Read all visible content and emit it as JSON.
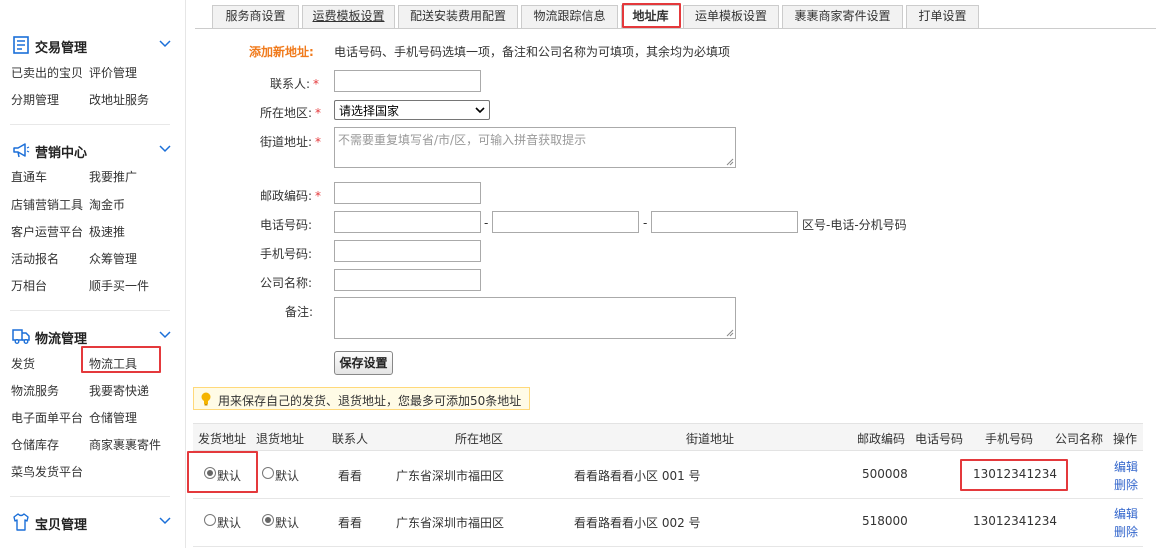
{
  "sidebar": {
    "sections": [
      {
        "title": "交易管理",
        "icon": "list-icon",
        "items": [
          "已卖出的宝贝",
          "评价管理",
          "分期管理",
          "改地址服务"
        ]
      },
      {
        "title": "营销中心",
        "icon": "megaphone-icon",
        "items": [
          "直通车",
          "我要推广",
          "店铺营销工具",
          "淘金币",
          "客户运营平台",
          "极速推",
          "活动报名",
          "众筹管理",
          "万相台",
          "顺手买一件"
        ]
      },
      {
        "title": "物流管理",
        "icon": "truck-icon",
        "items": [
          "发货",
          "物流工具",
          "物流服务",
          "我要寄快递",
          "电子面单平台",
          "仓储管理",
          "仓储库存",
          "商家裹裹寄件",
          "菜鸟发货平台"
        ]
      },
      {
        "title": "宝贝管理",
        "icon": "shirt-icon",
        "items": []
      }
    ]
  },
  "tabs": [
    "服务商设置",
    "运费模板设置",
    "配送安装费用配置",
    "物流跟踪信息",
    "地址库",
    "运单模板设置",
    "裹裹商家寄件设置",
    "打单设置"
  ],
  "active_tab": "地址库",
  "form": {
    "add_label": "添加新地址:",
    "instruction": "电话号码、手机号码选填一项，备注和公司名称为可填项，其余均为必填项",
    "contact_label": "联系人:",
    "region_label": "所在地区:",
    "region_select": "请选择国家",
    "street_label": "街道地址:",
    "street_placeholder": "不需要重复填写省/市/区，可输入拼音获取提示",
    "postcode_label": "邮政编码:",
    "phone_label": "电话号码:",
    "phone_sep": "-",
    "phone_hint": "区号-电话-分机号码",
    "mobile_label": "手机号码:",
    "company_label": "公司名称:",
    "remark_label": "备注:",
    "required_mark": "*",
    "save_button": "保存设置"
  },
  "tip": "用来保存自己的发货、退货地址，您最多可添加50条地址",
  "table": {
    "headers": [
      "发货地址",
      "退货地址",
      "联系人",
      "所在地区",
      "街道地址",
      "邮政编码",
      "电话号码",
      "手机号码",
      "公司名称",
      "操作"
    ],
    "rows": [
      {
        "ship_default": true,
        "return_default": false,
        "ship_label": "默认",
        "return_label": "默认",
        "contact": "看看",
        "region": "广东省深圳市福田区",
        "street": "看看路看看小区 001 号",
        "postcode": "500008",
        "phone": "",
        "mobile": "13012341234",
        "company": "",
        "edit": "编辑",
        "delete": "删除"
      },
      {
        "ship_default": false,
        "return_default": true,
        "ship_label": "默认",
        "return_label": "默认",
        "contact": "看看",
        "region": "广东省深圳市福田区",
        "street": "看看路看看小区 002 号",
        "postcode": "518000",
        "phone": "",
        "mobile": "13012341234",
        "company": "",
        "edit": "编辑",
        "delete": "删除"
      }
    ]
  },
  "colors": {
    "highlight": "#e4393c",
    "link": "#3366cc",
    "accent_orange": "#f07b1d",
    "sidebar_icon": "#1b6fd8"
  }
}
